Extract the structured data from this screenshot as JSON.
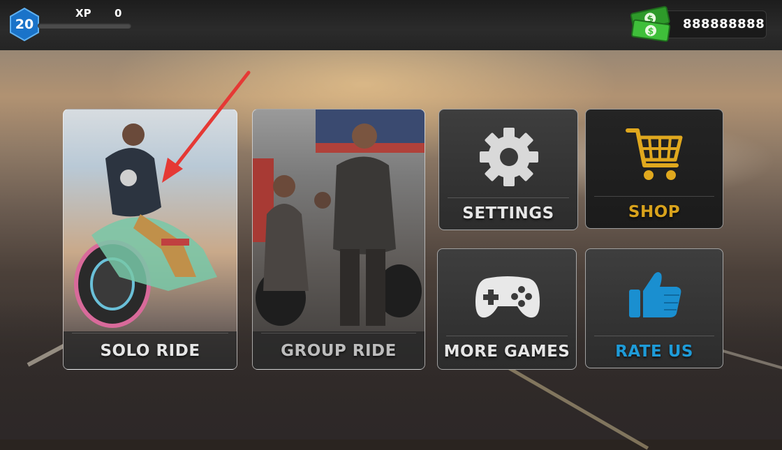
{
  "hud": {
    "level": "20",
    "xp_label": "XP",
    "xp_value": "0",
    "xp_progress_fraction": 0,
    "cash": "888888888"
  },
  "menu": {
    "solo_ride": "SOLO RIDE",
    "group_ride": "GROUP RIDE",
    "settings": "SETTINGS",
    "shop": "SHOP",
    "more_games": "MORE GAMES",
    "rate_us": "RATE US"
  },
  "colors": {
    "level_badge": "#1a73c9",
    "xp_fill": "#3fa8e0",
    "shop_label": "#d8a21c",
    "shop_cart": "#e0a81e",
    "rate_label": "#1e9bd8",
    "thumb_icon": "#1a8fd0",
    "cash_green": "#3fbf3a",
    "annotation_arrow": "#e53935",
    "menu_label": "#e6e6e6",
    "group_ride_label": "#bdbdbd"
  },
  "icons": {
    "settings": "gear-icon",
    "shop": "shopping-cart-icon",
    "more_games": "gamepad-icon",
    "rate_us": "thumbs-up-icon",
    "cash": "cash-bills-icon",
    "level": "hexagon-level-icon"
  }
}
